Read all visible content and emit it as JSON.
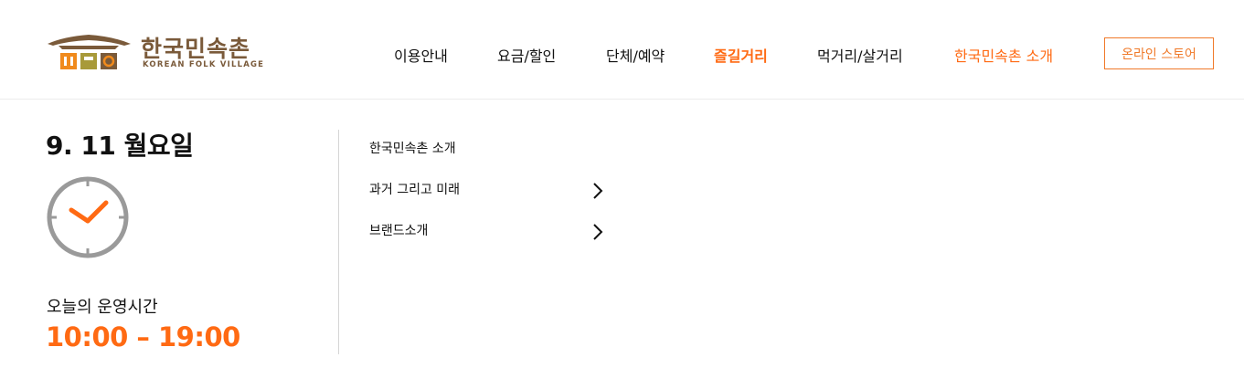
{
  "logo": {
    "korean": "한국민속촌",
    "english": "KOREAN FOLK VILLAGE",
    "colors": {
      "brown": "#7a5a3a",
      "orange": "#f08a1c",
      "olive": "#a89a3a"
    }
  },
  "nav": {
    "items": [
      {
        "label": "이용안내"
      },
      {
        "label": "요금/할인"
      },
      {
        "label": "단체/예약"
      },
      {
        "label": "즐길거리"
      },
      {
        "label": "먹거리/살거리"
      },
      {
        "label": "한국민속촌 소개"
      }
    ],
    "store_button": "온라인 스토어"
  },
  "today": {
    "date": "9. 11 월요일",
    "hours_label": "오늘의 운영시간",
    "hours": "10:00 – 19:00"
  },
  "submenu": {
    "items": [
      {
        "label": "한국민속촌 소개",
        "icon": null
      },
      {
        "label": "과거 그리고 미래",
        "icon": "chevron-right-icon"
      },
      {
        "label": "브랜드소개",
        "icon": "chevron-right-icon"
      }
    ]
  },
  "colors": {
    "accent": "#ff6a13",
    "text": "#111111",
    "divider": "#d6d6d6",
    "clock_gray": "#9a9a9a"
  }
}
